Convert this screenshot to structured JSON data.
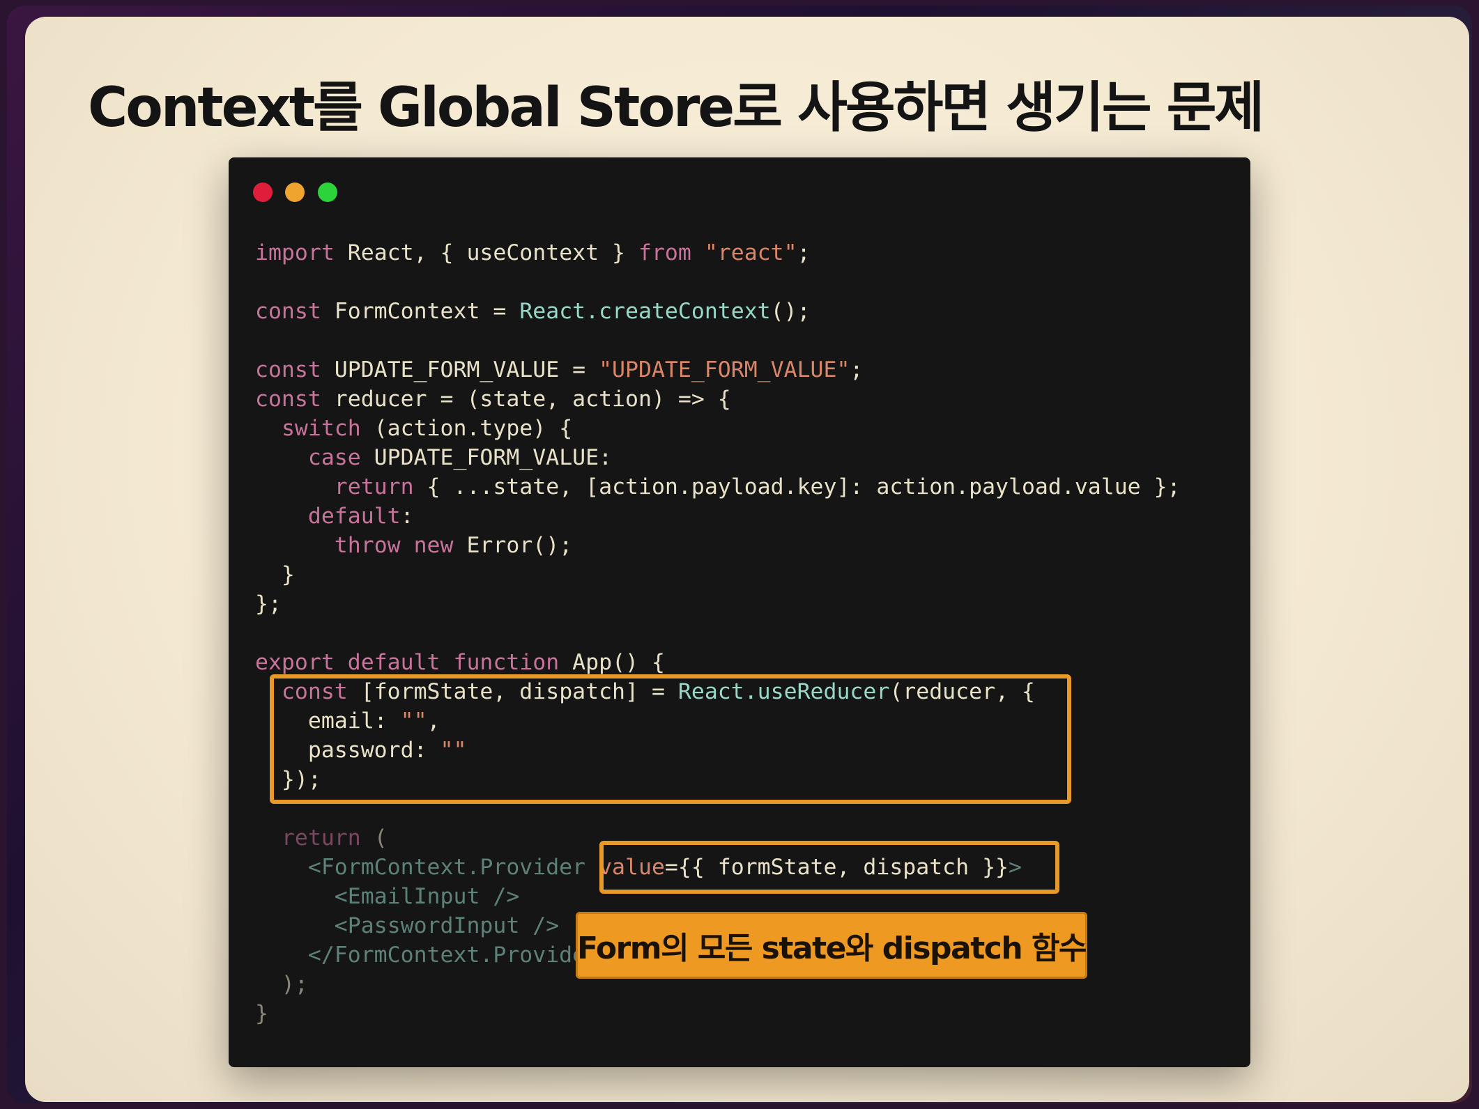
{
  "slide": {
    "title": "Context를 Global Store로 사용하면 생기는 문제",
    "annotation": "Form의 모든 state와 dispatch 함수"
  },
  "code": {
    "line_import": [
      "import",
      " React, { useContext } ",
      "from",
      " ",
      "\"react\"",
      ";"
    ],
    "line_createContext": [
      "const",
      " FormContext = ",
      "React.createContext",
      "();"
    ],
    "line_update": [
      "const",
      " UPDATE_FORM_VALUE = ",
      "\"UPDATE_FORM_VALUE\"",
      ";"
    ],
    "line_reducer": [
      "const",
      " reducer = (state, action) => {"
    ],
    "line_switch": [
      "  ",
      "switch",
      " (action.type) {"
    ],
    "line_case": [
      "    ",
      "case",
      " UPDATE_FORM_VALUE:"
    ],
    "line_return_spread": [
      "      ",
      "return",
      " { ...state, [action.payload.key]: action.payload.value };"
    ],
    "line_default": [
      "    ",
      "default",
      ":"
    ],
    "line_throw": [
      "      ",
      "throw",
      " ",
      "new",
      " Error();"
    ],
    "line_close_switch": "  }",
    "line_close_reducer": "};",
    "line_export": [
      "export",
      " ",
      "default",
      " ",
      "function",
      " App() {"
    ],
    "line_useReducer": [
      "  ",
      "const",
      " [formState, dispatch] = ",
      "React.useReducer",
      "(reducer, {"
    ],
    "line_email": [
      "    email: ",
      "\"\"",
      ","
    ],
    "line_password": [
      "    password: ",
      "\"\""
    ],
    "line_close_obj": "  });",
    "line_return": [
      "  ",
      "return",
      " ("
    ],
    "line_provider": [
      "    ",
      "<FormContext.Provider",
      " ",
      "value",
      "={{ formState, dispatch }}",
      ">"
    ],
    "line_email_input": [
      "      ",
      "<EmailInput />"
    ],
    "line_password_input": [
      "      ",
      "<PasswordInput />"
    ],
    "line_provider_close": [
      "    ",
      "</FormContext.Provider>"
    ],
    "line_close_return": "  );",
    "line_close_fn": "}"
  },
  "colors": {
    "keyword": "#c8739c",
    "string": "#d98669",
    "identifier": "#e9e2c9",
    "method": "#98d8c9",
    "highlight": "#e89a28"
  }
}
